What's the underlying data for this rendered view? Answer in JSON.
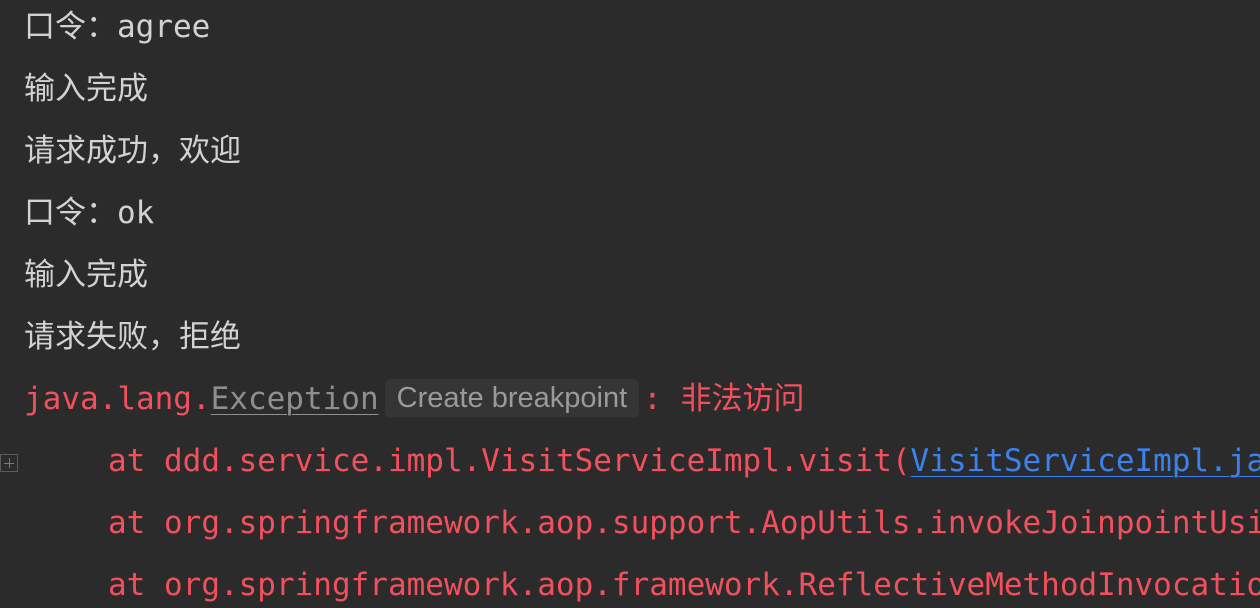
{
  "console": {
    "lines": [
      {
        "text": "口令：agree"
      },
      {
        "text": "输入完成"
      },
      {
        "text": "请求成功，欢迎"
      },
      {
        "text": "口令：ok"
      },
      {
        "text": "输入完成"
      },
      {
        "text": "请求失败，拒绝"
      }
    ],
    "exception": {
      "prefix": "java.lang.",
      "name": "Exception",
      "breakpoint_label": "Create breakpoint",
      "message": ": 非法访问"
    },
    "stack": [
      {
        "text": "at ddd.service.impl.VisitServiceImpl.visit(",
        "link": "VisitServiceImpl.java"
      },
      {
        "text": "at org.springframework.aop.support.AopUtils.invokeJoinpointUsingReflection",
        "link": ""
      },
      {
        "text": "at org.springframework.aop.framework.ReflectiveMethodInvocation.invokeJoinpoint",
        "link": ""
      }
    ]
  },
  "colors": {
    "background": "#2b2b2b",
    "text": "#d2d2d2",
    "error": "#f2505c",
    "link": "#3b82f0",
    "muted": "#8f8f8f"
  }
}
